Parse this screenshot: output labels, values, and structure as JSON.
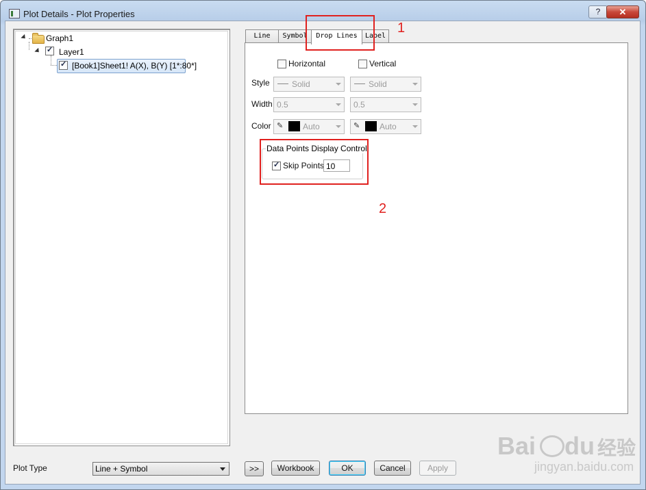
{
  "window": {
    "title": "Plot Details - Plot Properties",
    "help_label": "?",
    "close_label": "✕"
  },
  "tree": {
    "graph": "Graph1",
    "layer": "Layer1",
    "plot": "[Book1]Sheet1! A(X), B(Y) [1*:80*]"
  },
  "tabs": [
    "Line",
    "Symbol",
    "Drop Lines",
    "Label"
  ],
  "active_tab": "Drop Lines",
  "drop_lines": {
    "horizontal_label": "Horizontal",
    "vertical_label": "Vertical",
    "horizontal_checked": false,
    "vertical_checked": false,
    "style_label": "Style",
    "width_label": "Width",
    "color_label": "Color",
    "style_h": "Solid",
    "style_v": "Solid",
    "width_h": "0.5",
    "width_v": "0.5",
    "color_h": "Auto",
    "color_v": "Auto"
  },
  "data_points": {
    "group_title": "Data Points Display Control",
    "skip_label": "Skip Points",
    "skip_checked": true,
    "skip_value": "10"
  },
  "footer": {
    "plot_type_label": "Plot Type",
    "plot_type_value": "Line + Symbol",
    "expand_label": ">>",
    "workbook_label": "Workbook",
    "ok_label": "OK",
    "cancel_label": "Cancel",
    "apply_label": "Apply"
  },
  "annotations": {
    "marker_1": "1",
    "marker_2": "2",
    "color": "#e0201e"
  },
  "watermark": {
    "brand": "Bai",
    "brand2": "du",
    "brand_cn": "经验",
    "url": "jingyan.baidu.com"
  }
}
